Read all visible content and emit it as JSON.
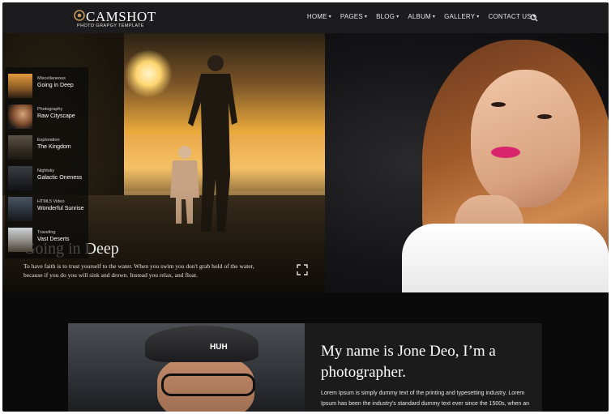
{
  "brand": {
    "title": "CAMSHOT",
    "subtitle": "PHOTO GRAPGY TEMPLATE"
  },
  "nav": {
    "items": [
      {
        "label": "HOME",
        "chevron": true
      },
      {
        "label": "PAGES",
        "chevron": true
      },
      {
        "label": "BLOG",
        "chevron": true
      },
      {
        "label": "ALBUM",
        "chevron": true
      },
      {
        "label": "GALLERY",
        "chevron": true
      },
      {
        "label": "CONTACT US",
        "chevron": true
      }
    ],
    "search_icon": "search-icon"
  },
  "hero": {
    "title": "Going in Deep",
    "text": "To have faith is to trust yourself to the water. When you swim you don't grab hold of the water, because if you do you will sink and drown. Instead you relax, and float.",
    "expand_icon": "expand-icon"
  },
  "slider": {
    "items": [
      {
        "category": "Miscellaneous",
        "title": "Going in Deep"
      },
      {
        "category": "Photography",
        "title": "Raw Cityscape"
      },
      {
        "category": "Exploration",
        "title": "The Kingdom"
      },
      {
        "category": "Nightsky",
        "title": "Galactic Oneness"
      },
      {
        "category": "HTML5 Video",
        "title": "Wonderful Sunrise"
      },
      {
        "category": "Traveling",
        "title": "Vast Deserts"
      }
    ]
  },
  "about": {
    "title": "My name is Jone Deo, I’m a photographer.",
    "text": "Lorem Ipsum is simply dummy text of the printing and typesetting industry. Lorem Ipsum has been the industry's standard dummy text ever since the 1500s, when an unknown printer took a galley of type",
    "cap_text": "HUH"
  },
  "colors": {
    "header_bg": "#1c1c1e",
    "page_bg": "#0a0a0a",
    "lip_accent": "#d8256b"
  }
}
